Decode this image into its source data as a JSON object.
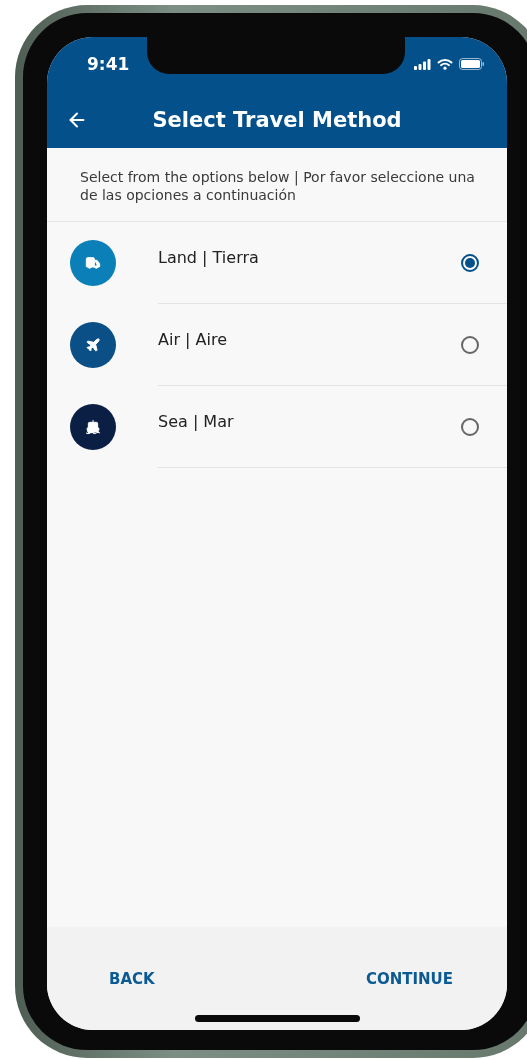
{
  "status_bar": {
    "time": "9:41"
  },
  "header": {
    "title": "Select Travel Method"
  },
  "instructions": "Select from the options below | Por favor seleccione una de las opciones a continuación",
  "options": [
    {
      "kind": "land",
      "label": "Land | Tierra",
      "color": "#0a7fb8",
      "selected": true
    },
    {
      "kind": "air",
      "label": "Air | Aire",
      "color": "#0a4f86",
      "selected": false
    },
    {
      "kind": "sea",
      "label": "Sea | Mar",
      "color": "#0b1f45",
      "selected": false
    }
  ],
  "footer": {
    "back": "BACK",
    "continue": "CONTINUE"
  }
}
